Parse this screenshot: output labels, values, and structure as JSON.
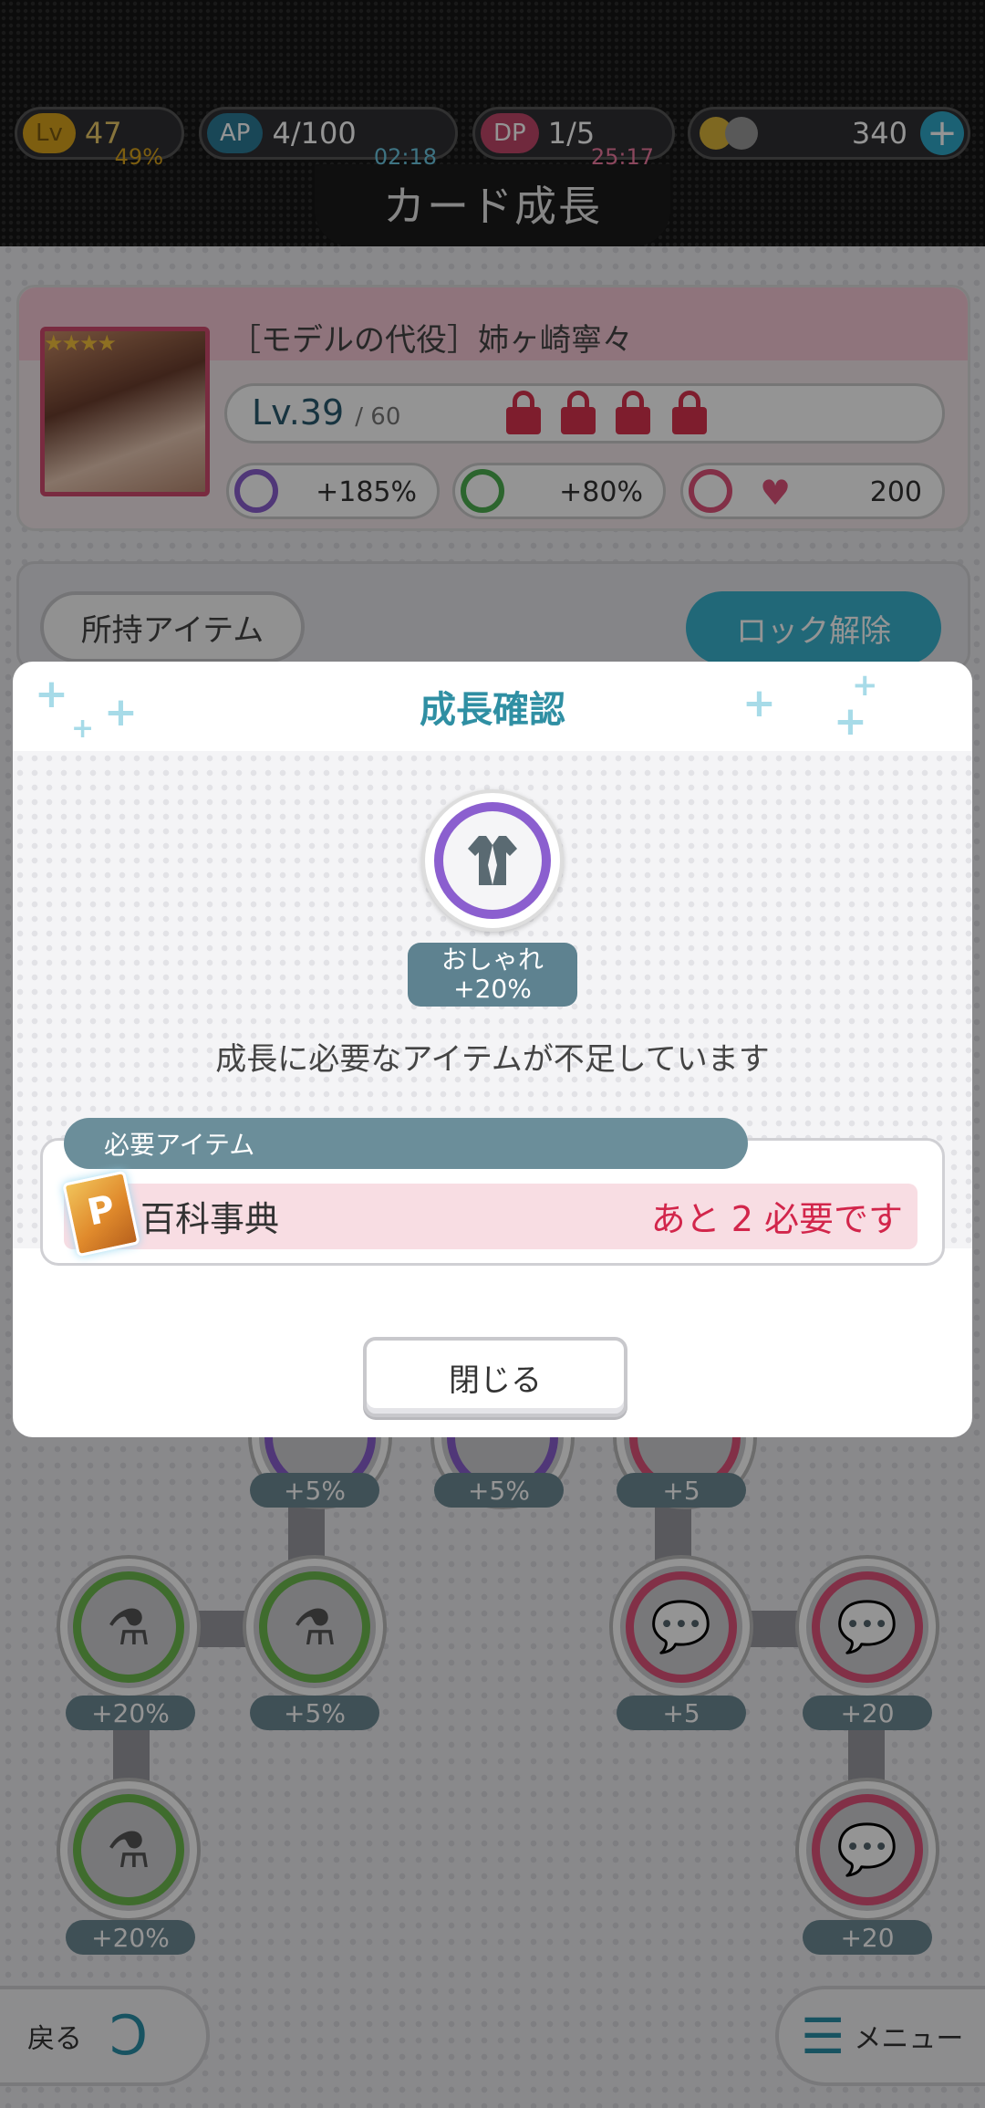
{
  "status": {
    "lv_label": "Lv",
    "lv_value": "47",
    "lv_percent": "49%",
    "ap_label": "AP",
    "ap_value": "4/100",
    "ap_timer": "02:18",
    "dp_label": "DP",
    "dp_value": "1/5",
    "dp_timer": "25:17",
    "coin_value": "340",
    "add_label": "+"
  },
  "page": {
    "title": "カード成長"
  },
  "card": {
    "name": "［モデルの代役］姉ヶ崎寧々",
    "stars": "★★★★",
    "level": "Lv.39",
    "level_max": "/ 60",
    "stats": [
      {
        "label": "+185%",
        "icon": "fashion-icon",
        "color": "#8b5fcf"
      },
      {
        "label": "+80%",
        "icon": "flask-icon",
        "color": "#4caf50"
      },
      {
        "label": "200",
        "icon": "heart-chat-icon",
        "color": "#e0537a"
      }
    ]
  },
  "items_bar": {
    "owned_label": "所持アイテム",
    "unlock_label": "ロック解除"
  },
  "tree": {
    "labels": [
      "+5%",
      "+5%",
      "+5",
      "+20%",
      "+5%",
      "+5",
      "+20",
      "+20%",
      "+20"
    ]
  },
  "footer": {
    "back_label": "戻る",
    "menu_label": "メニュー"
  },
  "dialog": {
    "title": "成長確認",
    "effect_name": "おしゃれ",
    "effect_value": "+20%",
    "message": "成長に必要なアイテムが不足しています",
    "required_header": "必要アイテム",
    "item_name": "百科事典",
    "item_need": "あと 2 必要です",
    "close_label": "閉じる"
  }
}
